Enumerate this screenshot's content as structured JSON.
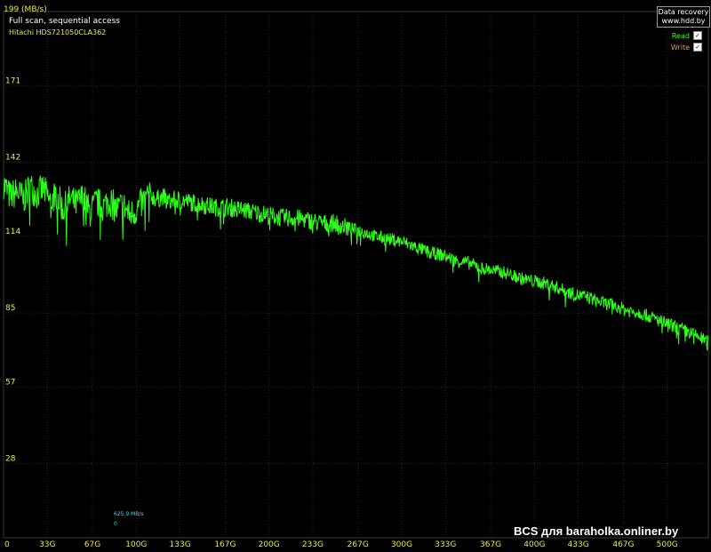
{
  "header": {
    "title": "Full scan, sequential access",
    "drive": "Hitachi HDS721050CLA362",
    "ylabel": "199 (MB/s)"
  },
  "brand": {
    "line1": "Data recovery",
    "line2": "www.hdd.by"
  },
  "legend": {
    "read_label": "Read",
    "write_label": "Write",
    "read_checked": "✓",
    "write_checked": "✓"
  },
  "info": {
    "rate": "625.9 MB/s",
    "value": "0"
  },
  "watermark": "BCS для baraholka.onliner.by",
  "colors": {
    "background": "#000000",
    "grid": "#2a2a2a",
    "read": "#2eff1a",
    "axis_text": "#e8e84a",
    "info_text": "#40d8f0"
  },
  "chart_data": {
    "type": "line",
    "xlabel": "",
    "ylabel": "199 (MB/s)",
    "ylim": [
      0,
      199
    ],
    "xlim": [
      0,
      531
    ],
    "y_ticks": [
      28,
      57,
      85,
      114,
      142,
      171
    ],
    "x_ticks": [
      "0",
      "33G",
      "67G",
      "100G",
      "133G",
      "167G",
      "200G",
      "233G",
      "267G",
      "300G",
      "333G",
      "367G",
      "400G",
      "433G",
      "467G",
      "500G"
    ],
    "x_tick_values": [
      0,
      33,
      67,
      100,
      133,
      167,
      200,
      233,
      267,
      300,
      333,
      367,
      400,
      433,
      467,
      500
    ],
    "grid": true,
    "legend_placement": "top-right",
    "series": [
      {
        "name": "Read",
        "x": [
          0,
          5,
          10,
          15,
          20,
          25,
          30,
          35,
          40,
          45,
          50,
          55,
          60,
          65,
          70,
          75,
          80,
          85,
          90,
          95,
          100,
          105,
          110,
          115,
          120,
          125,
          130,
          140,
          150,
          160,
          170,
          180,
          190,
          200,
          210,
          220,
          230,
          240,
          250,
          260,
          270,
          280,
          290,
          300,
          310,
          320,
          330,
          340,
          350,
          360,
          370,
          380,
          390,
          400,
          410,
          420,
          430,
          440,
          450,
          460,
          470,
          480,
          490,
          500,
          510,
          520,
          531
        ],
        "y": [
          134,
          129,
          131,
          128,
          133,
          130,
          132,
          127,
          130,
          124,
          128,
          126,
          129,
          123,
          127,
          125,
          128,
          124,
          126,
          122,
          124,
          127,
          130,
          128,
          129,
          127,
          128,
          127,
          126,
          125,
          125,
          124,
          123,
          122,
          121,
          121,
          120,
          119,
          119,
          117,
          116,
          114,
          113,
          112,
          110,
          108,
          107,
          105,
          104,
          102,
          101,
          100,
          98,
          97,
          96,
          94,
          92,
          91,
          89,
          88,
          86,
          85,
          83,
          81,
          79,
          77,
          74
        ]
      }
    ]
  }
}
